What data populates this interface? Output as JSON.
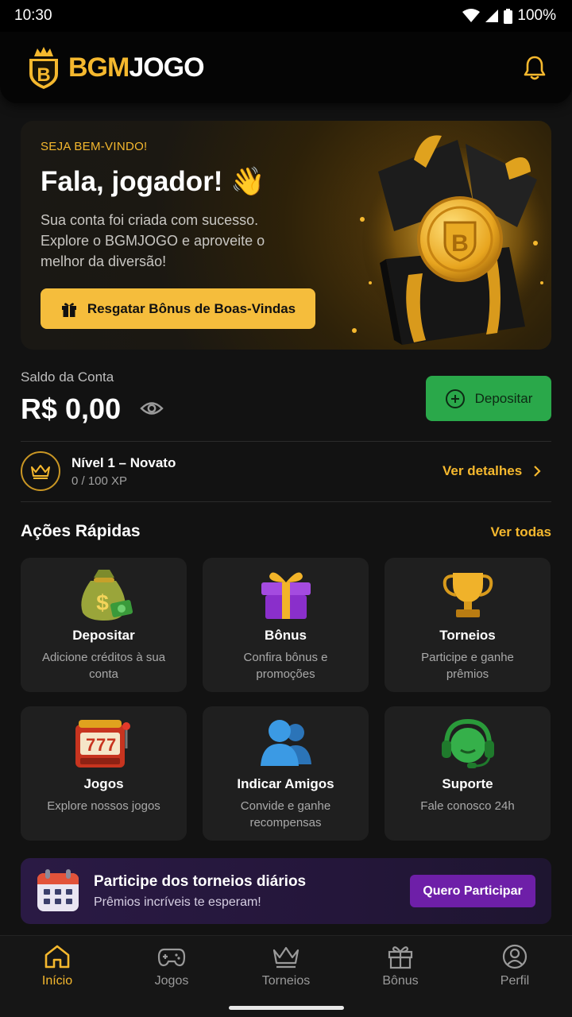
{
  "status_bar": {
    "time": "10:30",
    "battery": "100%"
  },
  "header": {
    "logo_gold": "BGM",
    "logo_white": "JOGO",
    "icons": {
      "logo": "shield-crown-b-icon",
      "notifications": "bell-icon"
    }
  },
  "hero": {
    "kicker": "SEJA BEM-VINDO!",
    "title": "Fala, jogador! 👋",
    "description": "Sua conta foi criada com sucesso. Explore o BGMJOGO e aproveite o melhor da diversão!",
    "button_label": "Resgatar Bônus de Boas-Vindas",
    "button_icon": "gift-icon",
    "art": "gift-box-gold-coin-illustration"
  },
  "balance": {
    "label": "Saldo da Conta",
    "value": "R$ 0,00",
    "deposit_label": "Depositar",
    "deposit_icon": "plus-circle-icon"
  },
  "level": {
    "title": "Nível 1 – Novato",
    "xp": "0 / 100 XP",
    "link_label": "Ver detalhes",
    "icon": "crown-icon"
  },
  "quick_actions": {
    "title": "Ações Rápidas",
    "link_label": "Ver todas",
    "cards": [
      {
        "title": "Depositar",
        "desc": "Adicione créditos à sua conta",
        "icon": "money-bag-icon"
      },
      {
        "title": "Bônus",
        "desc": "Confira bônus e promoções",
        "icon": "gift-icon"
      },
      {
        "title": "Torneios",
        "desc": "Participe e ganhe prêmios",
        "icon": "trophy-icon"
      },
      {
        "title": "Jogos",
        "desc": "Explore nossos jogos",
        "icon": "slot-machine-icon"
      },
      {
        "title": "Indicar Amigos",
        "desc": "Convide e ganhe recompensas",
        "icon": "users-icon"
      },
      {
        "title": "Suporte",
        "desc": "Fale conosco 24h",
        "icon": "headset-icon"
      }
    ]
  },
  "promo": {
    "title": "Participe dos torneios diários",
    "subtitle": "Prêmios incríveis te esperam!",
    "button_label": "Quero Participar",
    "icon": "calendar-icon"
  },
  "bottom_nav": {
    "items": [
      {
        "label": "Início",
        "icon": "home-icon",
        "active": true
      },
      {
        "label": "Jogos",
        "icon": "gamepad-icon",
        "active": false
      },
      {
        "label": "Torneios",
        "icon": "crown-icon",
        "active": false
      },
      {
        "label": "Bônus",
        "icon": "gift-icon",
        "active": false
      },
      {
        "label": "Perfil",
        "icon": "user-circle-icon",
        "active": false
      }
    ]
  },
  "colors": {
    "accent": "#f5b82e",
    "deposit": "#2aa84a",
    "promo_button": "#6e1fa8",
    "background": "#121212"
  }
}
